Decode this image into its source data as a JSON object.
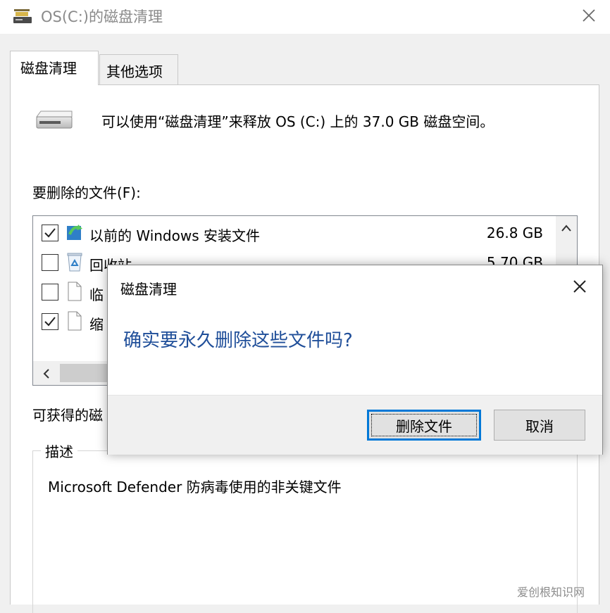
{
  "window": {
    "title": "OS(C:)的磁盘清理",
    "app_icon": "disk-cleanup-icon",
    "close_icon": "close-icon"
  },
  "tabs": [
    {
      "label": "磁盘清理",
      "active": true
    },
    {
      "label": "其他选项",
      "active": false
    }
  ],
  "main": {
    "intro": "可以使用“磁盘清理”来释放 OS (C:) 上的 37.0 GB 磁盘空间。",
    "files_label": "要删除的文件(F):",
    "files": [
      {
        "checked": true,
        "icon": "windows-setup-icon",
        "name": "以前的 Windows 安装文件",
        "size": "26.8 GB"
      },
      {
        "checked": false,
        "icon": "recycle-bin-icon",
        "name": "回收站",
        "size": "5.70 GB"
      },
      {
        "checked": false,
        "icon": "file-icon",
        "name": "临",
        "size": ""
      },
      {
        "checked": true,
        "icon": "file-icon",
        "name": "缩",
        "size": ""
      }
    ],
    "available_label": "可获得的磁",
    "description_legend": "描述",
    "description_text": "Microsoft Defender 防病毒使用的非关键文件"
  },
  "dialog": {
    "title": "磁盘清理",
    "question": "确实要永久删除这些文件吗?",
    "delete_button": "删除文件",
    "cancel_button": "取消"
  },
  "watermark": "爱创根知识网",
  "colors": {
    "accent": "#0078d7",
    "question_text": "#1f4e99",
    "window_bg": "#f0f0f0"
  }
}
